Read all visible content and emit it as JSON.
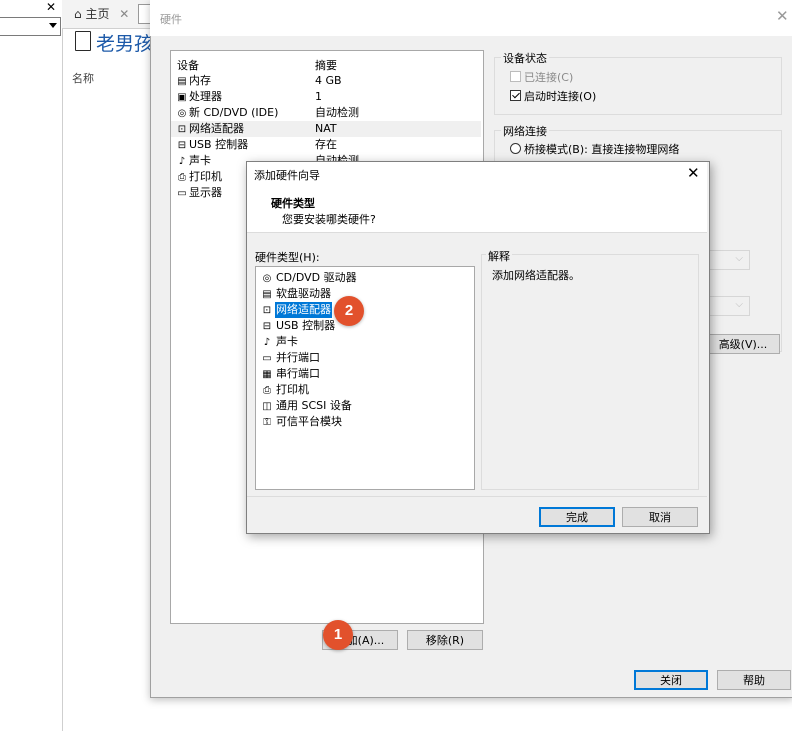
{
  "main": {
    "tab_home": "主页",
    "vm_title": "老男孩",
    "column_name": "名称"
  },
  "hw_dialog": {
    "title": "硬件",
    "list": {
      "header_device": "设备",
      "header_summary": "摘要",
      "rows": [
        {
          "icon": "memory-icon",
          "name": "内存",
          "summary": "4 GB"
        },
        {
          "icon": "cpu-icon",
          "name": "处理器",
          "summary": "1"
        },
        {
          "icon": "cd-icon",
          "name": "新 CD/DVD (IDE)",
          "summary": "自动检测"
        },
        {
          "icon": "network-icon",
          "name": "网络适配器",
          "summary": "NAT"
        },
        {
          "icon": "usb-icon",
          "name": "USB 控制器",
          "summary": "存在"
        },
        {
          "icon": "sound-icon",
          "name": "声卡",
          "summary": "自动检测"
        },
        {
          "icon": "printer-icon",
          "name": "打印机",
          "summary": ""
        },
        {
          "icon": "display-icon",
          "name": "显示器",
          "summary": ""
        }
      ]
    },
    "device_status": {
      "label": "设备状态",
      "connected": "已连接(C)",
      "connect_at_poweron": "启动时连接(O)"
    },
    "network_connection": {
      "label": "网络连接",
      "bridged": "桥接模式(B): 直接连接物理网络"
    },
    "advanced_button": "高级(V)...",
    "add_button": "添加(A)...",
    "remove_button": "移除(R)",
    "close_button": "关闭",
    "help_button": "帮助"
  },
  "wizard": {
    "title": "添加硬件向导",
    "heading": "硬件类型",
    "subheading": "您要安装哪类硬件?",
    "hw_type_label": "硬件类型(H):",
    "items": [
      {
        "icon": "cd-icon",
        "label": "CD/DVD 驱动器"
      },
      {
        "icon": "floppy-icon",
        "label": "软盘驱动器"
      },
      {
        "icon": "network-icon",
        "label": "网络适配器"
      },
      {
        "icon": "usb-icon",
        "label": "USB 控制器"
      },
      {
        "icon": "sound-icon",
        "label": "声卡"
      },
      {
        "icon": "parallel-port-icon",
        "label": "并行端口"
      },
      {
        "icon": "serial-port-icon",
        "label": "串行端口"
      },
      {
        "icon": "printer-icon",
        "label": "打印机"
      },
      {
        "icon": "scsi-icon",
        "label": "通用 SCSI 设备"
      },
      {
        "icon": "tpm-icon",
        "label": "可信平台模块"
      }
    ],
    "explanation_label": "解释",
    "explanation_text": "添加网络适配器。",
    "finish_button": "完成",
    "cancel_button": "取消"
  },
  "badges": {
    "step1": "1",
    "step2": "2"
  },
  "colors": {
    "badge": "#e2512c",
    "selection": "#0078d7",
    "title_blue": "#1d5aa9"
  }
}
